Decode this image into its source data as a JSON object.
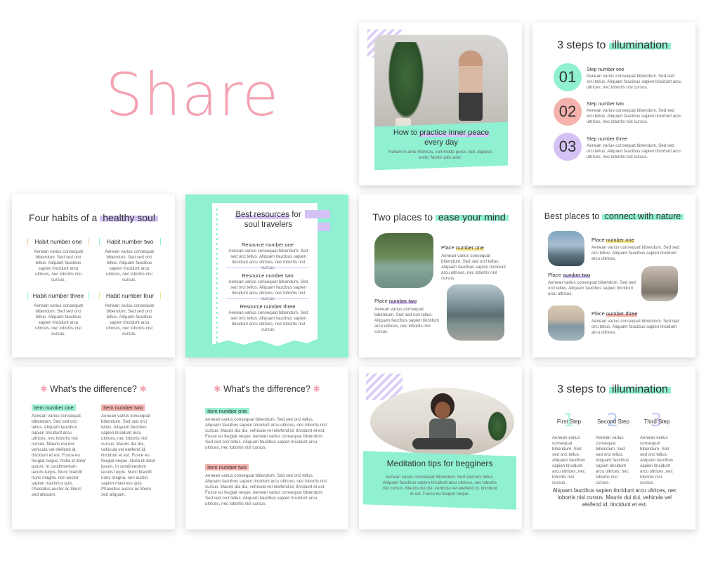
{
  "share_title": "Share",
  "colors": {
    "mint": "#8ff0d2",
    "pink": "#f4a3b4",
    "lavender": "#d4c2f5",
    "peach": "#f4b2ac"
  },
  "lorem_short": "Aenean varius consequat bibendum. Sed sed orci tellus. Aliquam faucibus sapien tincidunt arcu ultrices, nec lobortis nisl cursus.",
  "lorem_long": "Aenean varius consequat bibendum. Sed sed orci tellus. Aliquam faucibus sapien tincidunt arcu ultrices, nec lobortis nisl cursus. Mauris dui dui, vehicula vel eleifend id, tincidunt et est. Fusce eu feugiat neque. Aenean varius consequat bibendum. Sed sed orci tellus. Aliquam faucibus sapien tincidunt arcu ultrices, nec lobortis nisl cursus.",
  "lorem_col": "Aenean varius consequat bibendum. Sed sed orci tellus. Aliquam faucibus sapien tincidunt arcu ultrices, nec lobortis nisl cursus. Mauris dui dui, vehicula vel eleifend id, tincidunt et est. Fusce eu feugiat neque. Nulla id dolor ipsum. In condimentum iaculis turpis. Nunc blandit nunc magna, non auctor sapien maximus quis. Phasellus auctor ac libero sed aliquam.",
  "card_peace": {
    "title_a": "How to ",
    "title_b": "practice inner peace",
    "title_c": "every day",
    "body": "Nullam in ante rhoncus, commodo purus sed, dapibus enim. Morbi odio ante."
  },
  "card_steps1": {
    "title_a": "3 steps to ",
    "title_b": "illumination",
    "steps": [
      {
        "num": "01",
        "label": "Step number one",
        "text": "Aenean varius consequat bibendum. Sed sed orci tellus. Aliquam faucibus sapien tincidunt arcu ultrices, nec lobortis nisl cursus."
      },
      {
        "num": "02",
        "label": "Step number two",
        "text": "Aenean varius consequat bibendum. Sed sed orci tellus. Aliquam faucibus sapien tincidunt arcu ultrices, nec lobortis nisl cursus."
      },
      {
        "num": "03",
        "label": "Step number three",
        "text": "Aenean varius consequat bibendum. Sed sed orci tellus. Aliquam faucibus sapien tincidunt arcu ultrices, nec lobortis nisl cursus."
      }
    ]
  },
  "card_habits": {
    "title_a": "Four habits of a ",
    "title_b": "healthy soul",
    "habits": [
      "Habit number one",
      "Habit number two",
      "Habit number three",
      "Habit number four"
    ],
    "text": "Aenean varius consequat bibendum. Sed sed orci tellus. Aliquam faucibus sapien tincidunt arcu ultrices, nec lobortis nisl cursus."
  },
  "card_resources": {
    "title_a": "Best resources",
    "title_b": " for",
    "title_c": "soul travelers",
    "items": [
      "Resource number one",
      "Resource number two",
      "Resource number three"
    ],
    "text": "Aenean varius consequat bibendum. Sed sed orci tellus. Aliquam faucibus sapien tincidunt arcu ultrices, nec lobortis nisl cursus."
  },
  "card_two_places": {
    "title_a": "Two places to ",
    "title_b": "ease your mind",
    "place1_a": "Place ",
    "place1_b": "number one",
    "place2_a": "Place ",
    "place2_b": "number two",
    "text": "Aenean varius consequat bibendum. Sed sed orci tellus. Aliquam faucibus sapien tincidunt arcu ultrices, nec lobortis nisl cursus."
  },
  "card_best_places": {
    "title_a": "Best places to ",
    "title_b": "connect with nature",
    "place_a": "Place ",
    "p1": "number one",
    "p2": "number two",
    "p3": "number three",
    "text": "Aenean varius consequat bibendum. Sed sed orci tellus. Aliquam faucibus sapien tincidunt arcu ultrices."
  },
  "card_diff1": {
    "title": "What's the difference?",
    "item1": "Item number one",
    "item2": "Item number two"
  },
  "card_diff2": {
    "title": "What's the difference?",
    "item1": "Item number one",
    "item2": "Item number two",
    "text": "Aenean varius consequat bibendum. Sed sed orci tellus. Aliquam faucibus sapien tincidunt arcu ultrices, nec lobortis nisl cursus. Mauris dui dui, vehicula vel eleifend id, tincidunt et est. Fusce eu feugiat neque. Aenean varius consequat bibendum. Sed sed orci tellus. Aliquam faucibus sapien tincidunt arcu ultrices, nec lobortis nisl cursus."
  },
  "card_meditation": {
    "title": "Meditation tips for begginers",
    "body": "Aenean varius consequat bibendum. Sed sed orci tellus. Aliquam faucibus sapien tincidunt arcu ultrices, nec lobortis nisl cursus. Mauris dui dui, vehicula vel eleifend id, tincidunt et est. Fusce eu feugiat neque."
  },
  "card_steps2": {
    "title_a": "3 steps to ",
    "title_b": "illumination",
    "steps": [
      {
        "num": "1",
        "label": "First Step"
      },
      {
        "num": "2",
        "label": "Second Step"
      },
      {
        "num": "3",
        "label": "Third Step"
      }
    ],
    "text": "Aenean varius consequat bibendum. Sed sed orci tellus. Aliquam faucibus sapien tincidunt arcu ultrices, nec lobortis nisl cursus.",
    "footer": "Aliquam faucibus sapien tincidunt arcu ultrices, nec lobortis nisl cursus. Mauris dui dui, vehicula vel eleifend id, tincidunt et est."
  }
}
